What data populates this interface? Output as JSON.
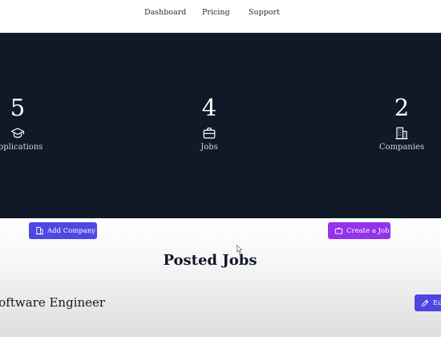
{
  "nav": {
    "links": [
      "Dashboard",
      "Pricing",
      "Support"
    ]
  },
  "stats": [
    {
      "value": "5",
      "label": "Applications",
      "icon": "graduation-cap-icon"
    },
    {
      "value": "4",
      "label": "Jobs",
      "icon": "briefcase-icon"
    },
    {
      "value": "2",
      "label": "Companies",
      "icon": "building-icon"
    }
  ],
  "actions": {
    "add_company": "Add Company",
    "create_job": "Create a Job"
  },
  "posted_jobs": {
    "title": "Posted Jobs",
    "items": [
      {
        "title": "Software Engineer",
        "edit_label": "Edit"
      }
    ]
  },
  "colors": {
    "hero_bg": "#111827",
    "indigo": "#4f46e5",
    "purple": "#9333ea"
  }
}
